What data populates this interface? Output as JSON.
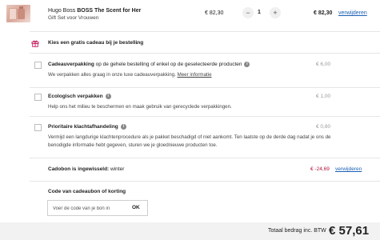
{
  "product": {
    "brand": "Hugo Boss",
    "name": "BOSS The Scent for Her",
    "subtitle": "Gift Set voor Vrouwen",
    "unit_price": "€ 82,30",
    "quantity": "1",
    "minus_symbol": "−",
    "plus_symbol": "+",
    "line_total": "€ 82,30",
    "remove_label": "verwijderen",
    "thumbnail_icon": "perfume-giftset-image"
  },
  "gift": {
    "label": "Kies een gratis cadeau bij je bestelling",
    "chevron": "⌄",
    "icon": "gift-icon",
    "accent": "#c2185b"
  },
  "options": [
    {
      "title_bold": "Cadeauverpakking",
      "title_rest": " op de gehele bestelling of enkel op de geselecteerde producten",
      "description": "We verpakken alles graag in onze luxe cadeauverpakking.",
      "link": "Meer informatie",
      "price": "€ 6,00"
    },
    {
      "title_bold": "Ecologisch verpakken",
      "title_rest": "",
      "description": "Help ons het milieu te beschermen en maak gebruik van gerecyclede verpakkingen.",
      "link": "",
      "price": "€ 1,00"
    },
    {
      "title_bold": "Prioritaire klachtafhandeling",
      "title_rest": "",
      "description": "Vermijd een langdurige klachtenprocedure als je pakket beschadigd of niet aankomt. Ten laatste op de derde dag nadat je ons de benodigde informatie hebt gegeven, sturen we je gloednieuwe producten toe.",
      "link": "",
      "price": "€ 0,80"
    }
  ],
  "coupon": {
    "label": "Cadobon is ingewisseld:",
    "code": " winter",
    "discount": "€ -24,69",
    "remove_label": "verwijderen",
    "discount_color": "#b3123b"
  },
  "voucher": {
    "title": "Code van cadeaubon of korting",
    "placeholder": "Voer de code van je bon in",
    "ok_label": "OK"
  },
  "total": {
    "label": "Totaal bedrag inc. BTW",
    "value": "€ 57,61"
  },
  "info_icon_glyph": "i"
}
